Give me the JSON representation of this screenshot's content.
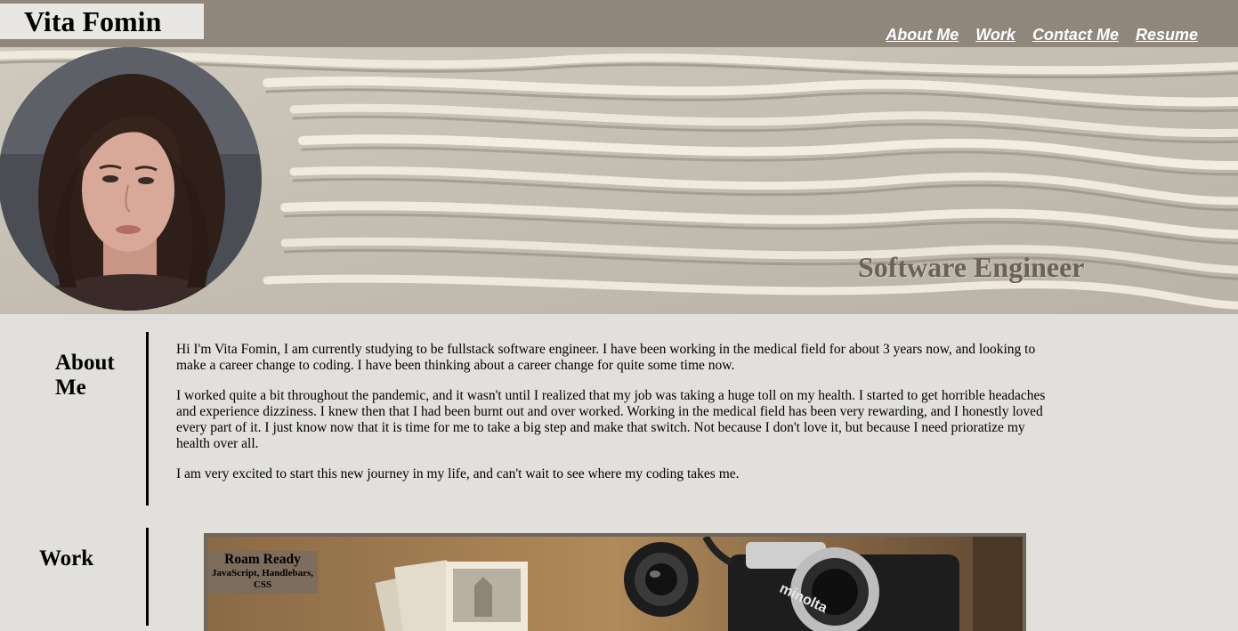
{
  "header": {
    "name": "Vita Fomin",
    "nav": [
      "About Me",
      "Work",
      "Contact Me",
      "Resume"
    ]
  },
  "hero": {
    "title": "Software Engineer"
  },
  "about": {
    "heading": "About Me",
    "paragraphs": [
      "Hi I'm Vita Fomin, I am currently studying to be fullstack software engineer. I have been working in the medical field for about 3 years now, and looking to make a career change to coding. I have been thinking about a career change for quite some time now.",
      "I worked quite a bit throughout the pandemic, and it wasn't until I realized that my job was taking a huge toll on my health. I started to get horrible headaches and experience dizziness. I knew then that I had been burnt out and over worked. Working in the medical field has been very rewarding, and I honestly loved every part of it. I just know now that it is time for me to take a big step and make that switch. Not because I don't love it, but because I need prioratize my health over all.",
      "I am very excited to start this new journey in my life, and can't wait to see where my coding takes me."
    ]
  },
  "work": {
    "heading": "Work",
    "projects": [
      {
        "title": "Roam Ready",
        "tech": "JavaScript, Handlebars, CSS"
      }
    ]
  },
  "colors": {
    "header_bg": "#8f877c",
    "page_bg": "#e2e0dc",
    "hero_title": "#6b6156"
  }
}
